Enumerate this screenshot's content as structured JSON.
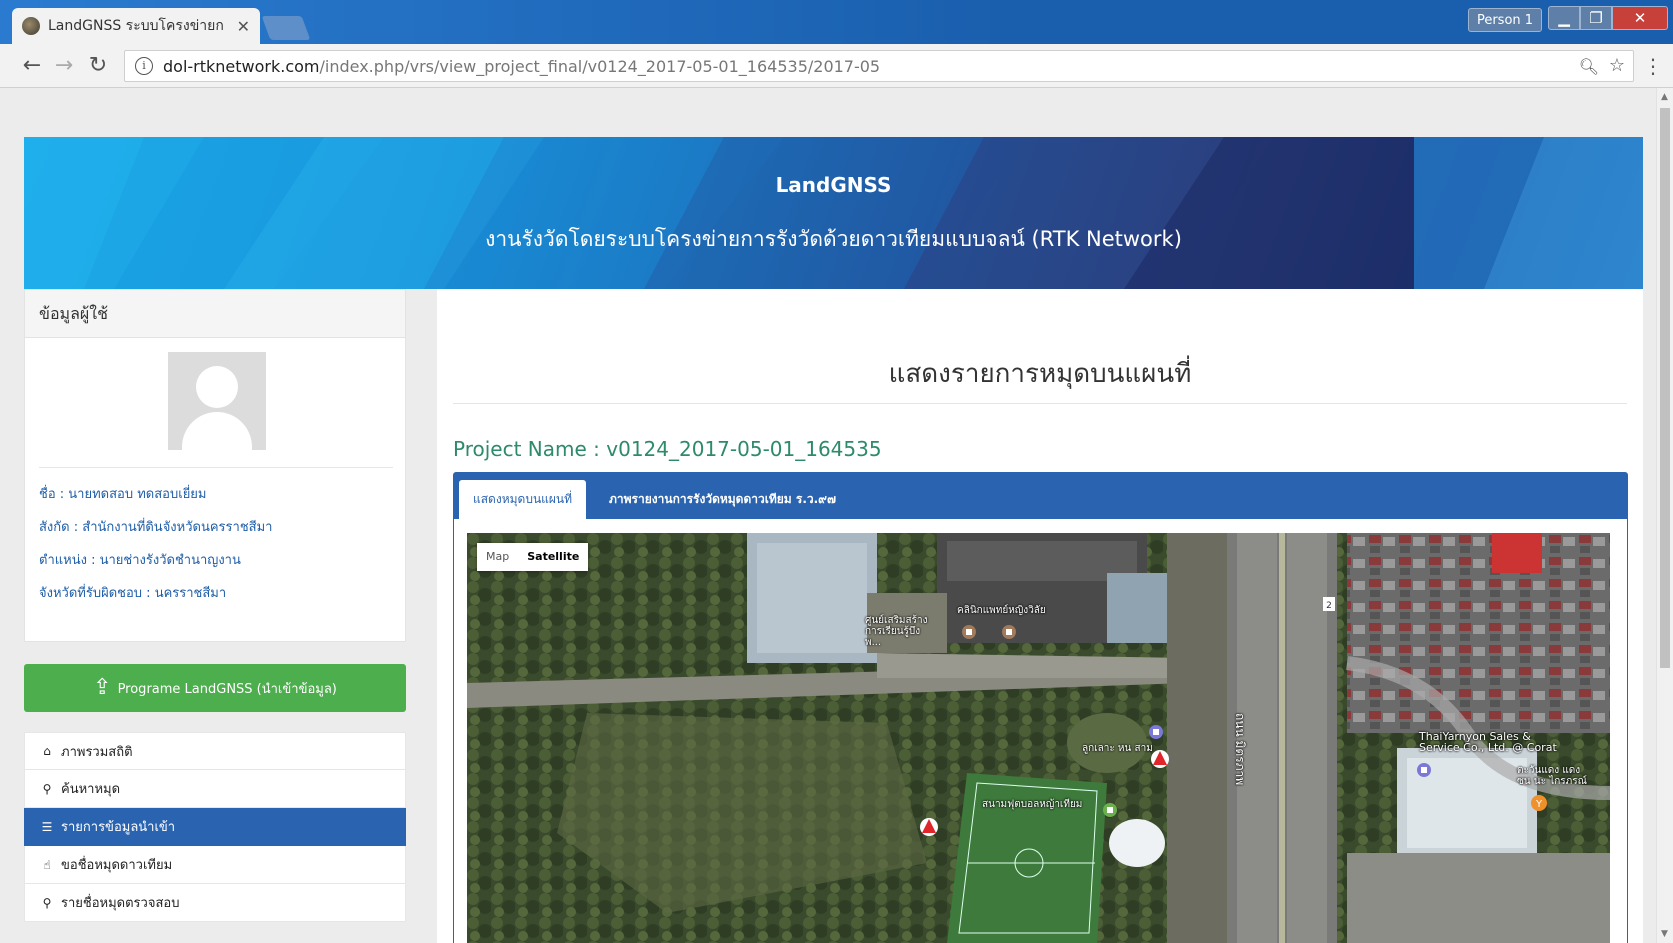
{
  "browser": {
    "tab_title": "LandGNSS ระบบโครงข่ายก",
    "tab_close": "✕",
    "profile": "Person 1",
    "url_domain": "dol-rtknetwork.com",
    "url_path": "/index.php/vrs/view_project_final/v0124_2017-05-01_164535/2017-05"
  },
  "banner": {
    "title": "LandGNSS",
    "subtitle": "งานรังวัดโดยระบบโครงข่ายการรังวัดด้วยดาวเทียมแบบจลน์ (RTK Network)"
  },
  "user_panel": {
    "heading": "ข้อมูลผู้ใช้",
    "rows": [
      {
        "label": "ชื่อ",
        "value": "นายทดสอบ ทดสอบเยี่ยม"
      },
      {
        "label": "สังกัด",
        "value": "สำนักงานที่ดินจังหวัดนครราชสีมา"
      },
      {
        "label": "ตำแหน่ง",
        "value": "นายช่างรังวัดชำนาญงาน"
      },
      {
        "label": "จังหวัดที่รับผิดชอบ",
        "value": "นครราชสีมา"
      }
    ]
  },
  "import_button": "Programe LandGNSS (นำเข้าข้อมูล)",
  "menu": [
    {
      "icon": "home-icon",
      "label": "ภาพรวมสถิติ"
    },
    {
      "icon": "search-icon",
      "label": "ค้นหาหมุด"
    },
    {
      "icon": "list-icon",
      "label": "รายการข้อมูลนำเข้า",
      "active": true
    },
    {
      "icon": "hand-icon",
      "label": "ขอชื่อหมุดดาวเทียม"
    },
    {
      "icon": "map-pin-icon",
      "label": "รายชื่อหมุดตรวจสอบ"
    }
  ],
  "main": {
    "title": "แสดงรายการหมุดบนแผนที่",
    "project_label": "Project Name",
    "project_sep": ":",
    "project_value": "v0124_2017-05-01_164535",
    "tabs": [
      {
        "label": "แสดงหมุดบนแผนที่",
        "active": true
      },
      {
        "label": "ภาพรายงานการรังวัดหมุดดาวเทียม ร.ว.๙๗",
        "active": false
      }
    ]
  },
  "map": {
    "type_map": "Map",
    "type_satellite": "Satellite",
    "labels": {
      "place1": "ศูนย์เสริมสร้าง การเรียนรู้บึงพ...",
      "place2": "คลินิกแพทย์หญิงวิลัย",
      "place3": "ลูกเลาะ หน สาม",
      "place4": "สนามฟุตบอลหญ้าเทียม",
      "road": "ถนน มิตรภาพ",
      "place5": "ThaiYarnyon Sales & Service Co., Ltd. @ Corat",
      "place6": "ตะวันแดง แดง ซน นะ ไกรภรณ์"
    }
  },
  "colors": {
    "accent": "#2a64b0",
    "green": "#4cae4c",
    "marker_red": "#e0262a"
  }
}
